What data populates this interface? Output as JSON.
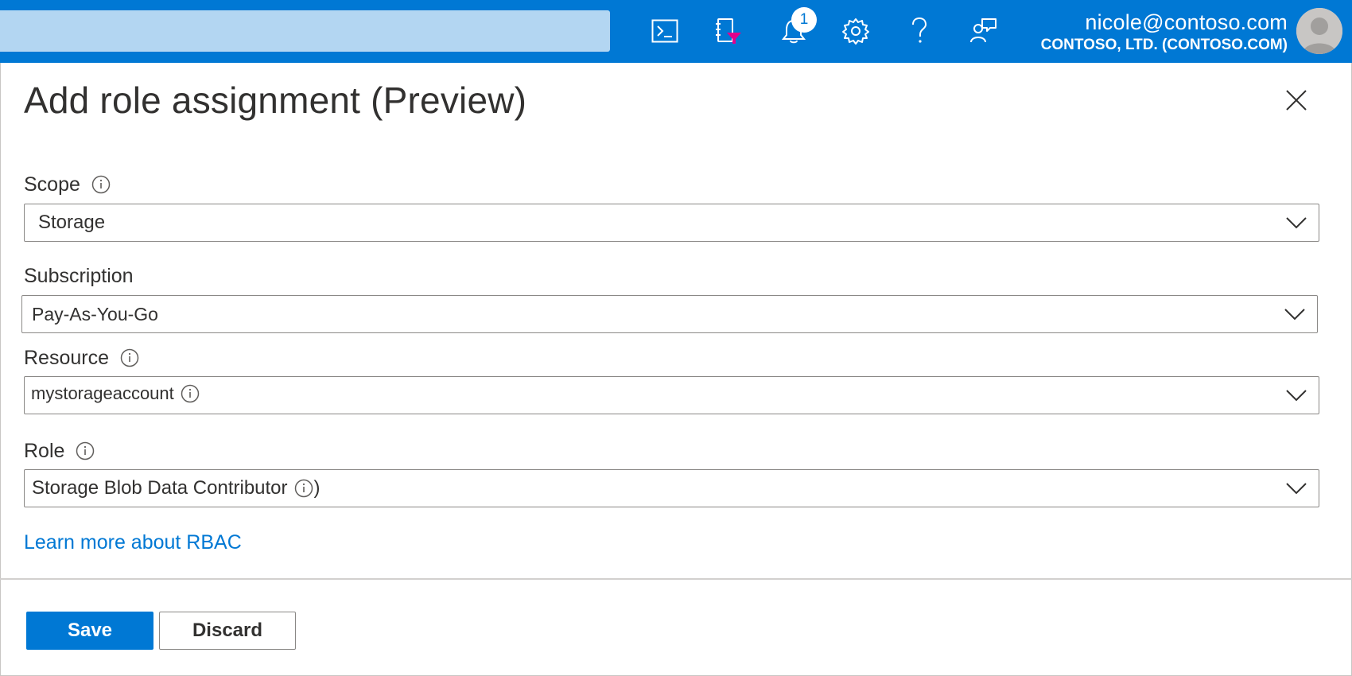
{
  "topbar": {
    "background": "#0078d4",
    "search_box_color": "#b3d6f2",
    "icons": [
      {
        "name": "cloud-shell-icon"
      },
      {
        "name": "directory-filter-icon"
      },
      {
        "name": "bell-icon"
      },
      {
        "name": "gear-icon"
      },
      {
        "name": "help-icon"
      },
      {
        "name": "feedback-icon"
      }
    ],
    "notification_count": "1",
    "account": {
      "email": "nicole@contoso.com",
      "tenant": "CONTOSO, LTD. (CONTOSO.COM)"
    }
  },
  "panel": {
    "title": "Add role assignment (Preview)"
  },
  "form": {
    "scope": {
      "label": "Scope",
      "value": "Storage"
    },
    "subscription": {
      "label": "Subscription",
      "value": "Pay-As-You-Go"
    },
    "resource": {
      "label": "Resource",
      "value": "mystorageaccount"
    },
    "role": {
      "label": "Role",
      "value": "Storage Blob Data Contributor",
      "trailing": ")"
    }
  },
  "links": {
    "learn_more": "Learn more about RBAC"
  },
  "footer": {
    "save_label": "Save",
    "discard_label": "Discard"
  },
  "colors": {
    "accent": "#0078d4",
    "text": "#323130",
    "border": "#8a8886"
  }
}
